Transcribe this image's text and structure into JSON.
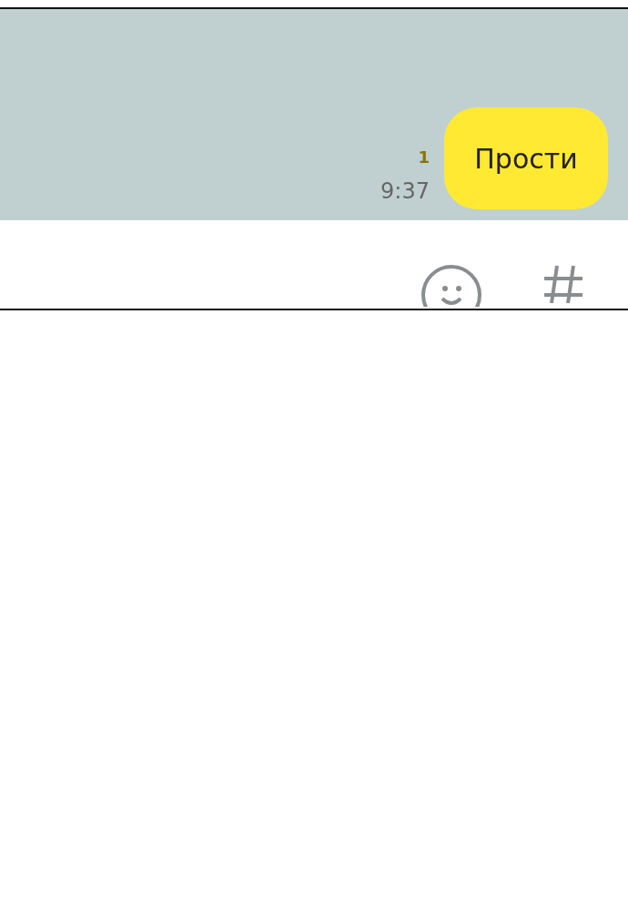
{
  "messages": [
    {
      "text": "Прости",
      "time": "9:37",
      "unread": "1",
      "outgoing": true
    }
  ]
}
